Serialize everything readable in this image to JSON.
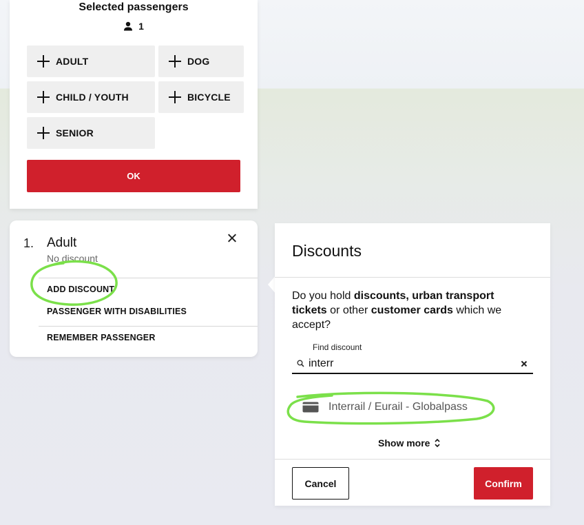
{
  "passenger_panel": {
    "title": "Selected passengers",
    "count": "1",
    "buttons": [
      "ADULT",
      "DOG",
      "CHILD / YOUTH",
      "BICYCLE",
      "SENIOR"
    ],
    "ok_label": "OK"
  },
  "passenger_card": {
    "number": "1.",
    "name": "Adult",
    "discount_status": "No discount",
    "actions": [
      "ADD DISCOUNT",
      "PASSENGER WITH DISABILITIES",
      "REMEMBER PASSENGER"
    ]
  },
  "discounts": {
    "title": "Discounts",
    "intro_1": "Do you hold ",
    "intro_bold_1": "discounts, urban transport tickets",
    "intro_2": " or other ",
    "intro_bold_2": "customer cards",
    "intro_3": " which we accept?",
    "search_label": "Find discount",
    "search_value": "interr",
    "result": "Interrail / Eurail - Globalpass",
    "show_more": "Show more",
    "cancel_label": "Cancel",
    "confirm_label": "Confirm"
  },
  "colors": {
    "primary_red": "#d0202c",
    "annotation_green": "#7be04a"
  }
}
